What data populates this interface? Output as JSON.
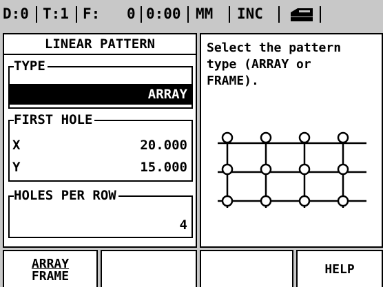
{
  "status_bar": {
    "datum": "D:0",
    "tool": "T:1",
    "feed_label": "F:",
    "feed_value": "0",
    "time": "0:00",
    "units": "MM",
    "mode": "INC",
    "icon": "toolbar-icon"
  },
  "form": {
    "title": "LINEAR PATTERN",
    "type_group": {
      "legend": "TYPE",
      "value": "ARRAY"
    },
    "first_hole_group": {
      "legend": "FIRST HOLE",
      "x_label": "X",
      "x_value": "20.000",
      "y_label": "Y",
      "y_value": "15.000"
    },
    "holes_per_row_group": {
      "legend": "HOLES PER ROW",
      "value": "4"
    }
  },
  "help": {
    "text": "Select the pattern\ntype (ARRAY or\nFRAME)."
  },
  "softkeys": {
    "key1_top": "ARRAY",
    "key1_bottom": "FRAME",
    "key2": "",
    "key3": "",
    "key4": "HELP"
  }
}
